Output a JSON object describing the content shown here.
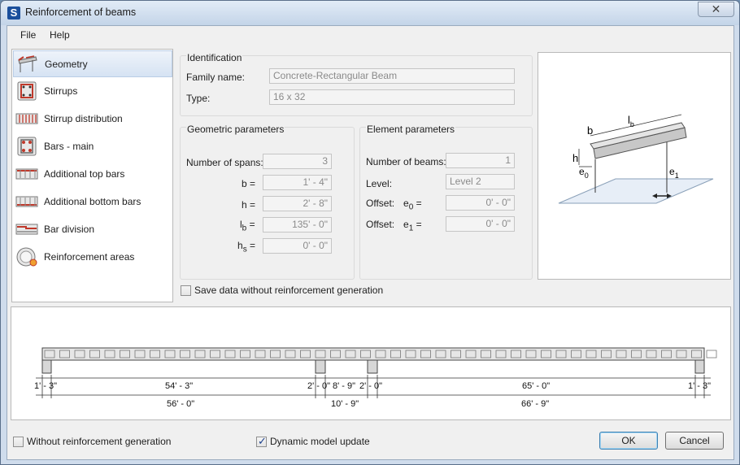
{
  "window": {
    "title": "Reinforcement of beams",
    "app_icon": "S",
    "close": "✕"
  },
  "menu": [
    "File",
    "Help"
  ],
  "sidebar": {
    "items": [
      {
        "label": "Geometry",
        "icon": "geometry-icon",
        "selected": true
      },
      {
        "label": "Stirrups",
        "icon": "stirrups-icon"
      },
      {
        "label": "Stirrup distribution",
        "icon": "stirrup-distribution-icon"
      },
      {
        "label": "Bars - main",
        "icon": "bars-main-icon"
      },
      {
        "label": "Additional top bars",
        "icon": "additional-top-bars-icon"
      },
      {
        "label": "Additional bottom bars",
        "icon": "additional-bottom-bars-icon"
      },
      {
        "label": "Bar division",
        "icon": "bar-division-icon"
      },
      {
        "label": "Reinforcement areas",
        "icon": "reinforcement-areas-icon"
      }
    ]
  },
  "identification": {
    "title": "Identification",
    "family_label": "Family name:",
    "family_value": "Concrete-Rectangular Beam",
    "type_label": "Type:",
    "type_value": "16 x 32"
  },
  "geometric": {
    "title": "Geometric parameters",
    "spans_label": "Number of spans:",
    "spans_value": "3",
    "b_label": "b =",
    "b_value": "1' - 4\"",
    "h_label": "h =",
    "h_value": "2' - 8\"",
    "lb_main": "l",
    "lb_sub": "b",
    "lb_eq": "=",
    "lb_value": "135' - 0\"",
    "hs_main": "h",
    "hs_sub": "s",
    "hs_eq": "=",
    "hs_value": "0' - 0\""
  },
  "element": {
    "title": "Element parameters",
    "beams_label": "Number of beams:",
    "beams_value": "1",
    "level_label": "Level:",
    "level_value": "Level 2",
    "offset0_label": "Offset:",
    "offset0_main": "e",
    "offset0_sub": "0",
    "offset0_eq": "=",
    "offset0_value": "0' - 0\"",
    "offset1_label": "Offset:",
    "offset1_main": "e",
    "offset1_sub": "1",
    "offset1_eq": "=",
    "offset1_value": "0' - 0\""
  },
  "preview": {
    "lb_main": "l",
    "lb_sub": "b",
    "b": "b",
    "h": "h",
    "e0_main": "e",
    "e0_sub": "0",
    "e1_main": "e",
    "e1_sub": "1"
  },
  "save_without_label": "Save data without reinforcement generation",
  "dims_top": [
    "1' - 3\"",
    "54' - 3\"",
    "2' - 0\"",
    "8' - 9\"",
    "2' - 0\"",
    "65' - 0\"",
    "1' - 3\""
  ],
  "dims_bottom": [
    "56' - 0\"",
    "10' - 9\"",
    "66' - 9\""
  ],
  "footer": {
    "without_label": "Without reinforcement generation",
    "without_checked": false,
    "dynamic_label": "Dynamic model update",
    "dynamic_checked": true,
    "ok": "OK",
    "cancel": "Cancel"
  }
}
